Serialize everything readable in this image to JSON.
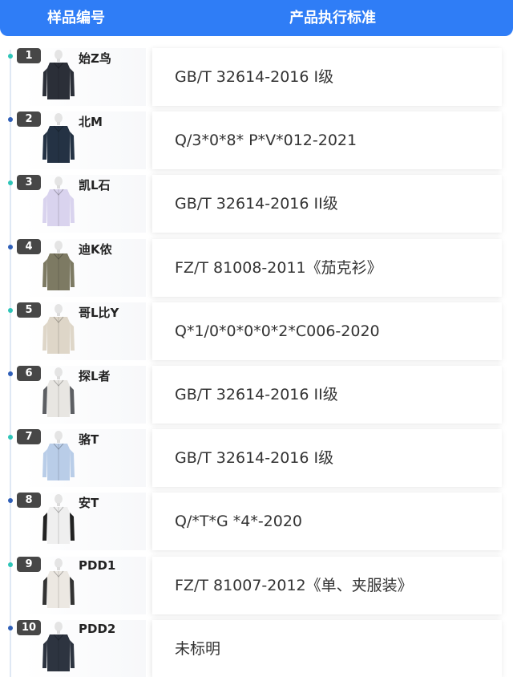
{
  "header": {
    "col1_label": "样品编号",
    "col2_label": "产品执行标准",
    "bg_color": "#2f7df6"
  },
  "rows": [
    {
      "num": "1",
      "brand": "始Z鸟",
      "standard": "GB/T 32614-2016 I级",
      "dot_color": "#2ec5b8",
      "jacket_color": "#2b2f38",
      "accent_color": "#2b2f38",
      "icon": "black-jacket-icon"
    },
    {
      "num": "2",
      "brand": "北M",
      "standard": "Q/3*0*8* P*V*012-2021",
      "dot_color": "#2f5fb8",
      "jacket_color": "#243244",
      "accent_color": "#243244",
      "icon": "navy-jacket-icon"
    },
    {
      "num": "3",
      "brand": "凯L石",
      "standard": "GB/T 32614-2016 II级",
      "dot_color": "#2ec5b8",
      "jacket_color": "#d9d3ee",
      "accent_color": "#d9d3ee",
      "icon": "lavender-jacket-icon"
    },
    {
      "num": "4",
      "brand": "迪K侬",
      "standard": "FZ/T 81008-2011《茄克衫》",
      "dot_color": "#2f5fb8",
      "jacket_color": "#7d7a63",
      "accent_color": "#7d7a63",
      "icon": "olive-jacket-icon"
    },
    {
      "num": "5",
      "brand": "哥L比Y",
      "standard": "Q*1/0*0*0*0*2*C006-2020",
      "dot_color": "#2ec5b8",
      "jacket_color": "#ded6c8",
      "accent_color": "#ded6c8",
      "icon": "beige-jacket-icon"
    },
    {
      "num": "6",
      "brand": "探L者",
      "standard": "GB/T 32614-2016 II级",
      "dot_color": "#2f5fb8",
      "jacket_color": "#e8e6e2",
      "accent_color": "#5d5f63",
      "icon": "grey-white-jacket-icon"
    },
    {
      "num": "7",
      "brand": "骆T",
      "standard": "GB/T 32614-2016 I级",
      "dot_color": "#2ec5b8",
      "jacket_color": "#b9cde8",
      "accent_color": "#b9cde8",
      "icon": "light-blue-jacket-icon"
    },
    {
      "num": "8",
      "brand": "安T",
      "standard": "Q/*T*G *4*-2020",
      "dot_color": "#2f5fb8",
      "jacket_color": "#efefef",
      "accent_color": "#222222",
      "icon": "black-white-jacket-icon"
    },
    {
      "num": "9",
      "brand": "PDD1",
      "standard": "FZ/T 81007-2012《单、夹服装》",
      "dot_color": "#2ec5b8",
      "jacket_color": "#ece8e2",
      "accent_color": "#333333",
      "icon": "cream-black-jacket-icon"
    },
    {
      "num": "10",
      "brand": "PDD2",
      "standard": "未标明",
      "dot_color": "#2f5fb8",
      "jacket_color": "#2d3440",
      "accent_color": "#2d3440",
      "icon": "dark-grey-jacket-icon"
    }
  ]
}
